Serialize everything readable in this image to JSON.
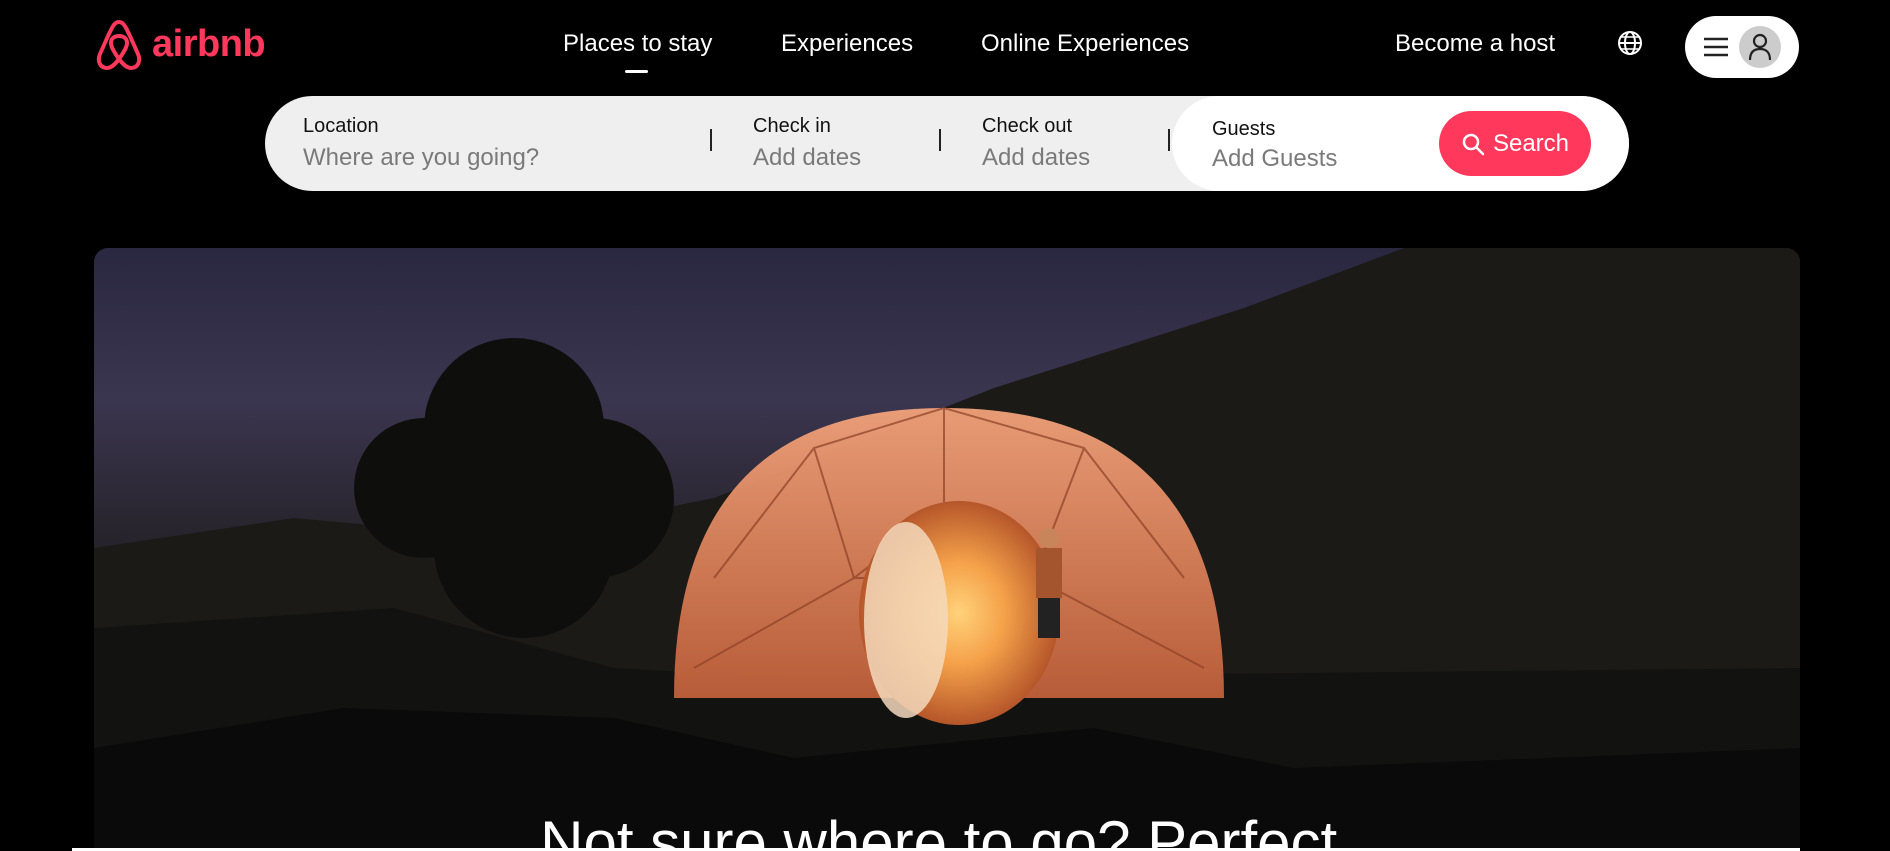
{
  "brand": {
    "name": "airbnb",
    "color": "#FF385C",
    "icon": "airbnb-logo-icon"
  },
  "nav": {
    "items": [
      {
        "label": "Places to stay",
        "active": true
      },
      {
        "label": "Experiences",
        "active": false
      },
      {
        "label": "Online Experiences",
        "active": false
      }
    ]
  },
  "header": {
    "host_label": "Become a host",
    "globe_icon": "globe-icon",
    "menu_icon": "hamburger-menu-icon",
    "user_icon": "user-avatar-icon"
  },
  "search": {
    "location": {
      "label": "Location",
      "placeholder": "Where are you going?"
    },
    "checkin": {
      "label": "Check in",
      "placeholder": "Add dates"
    },
    "checkout": {
      "label": "Check out",
      "placeholder": "Add dates"
    },
    "guests": {
      "label": "Guests",
      "placeholder": "Add Guests"
    },
    "button_label": "Search",
    "button_icon": "search-icon",
    "button_color": "#FF385C"
  },
  "hero": {
    "title": "Not sure where to go? Perfect."
  }
}
